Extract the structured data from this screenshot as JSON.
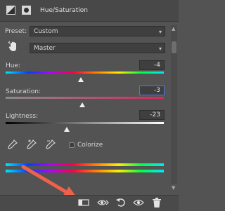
{
  "header": {
    "title": "Hue/Saturation",
    "icons": [
      "adjustment-layer-icon",
      "mask-icon"
    ]
  },
  "preset": {
    "label": "Preset:",
    "value": "Custom"
  },
  "channel": {
    "value": "Master",
    "icon": "targeted-adjustment-hand-icon"
  },
  "hue": {
    "label": "Hue:",
    "value": "-4",
    "level": -4
  },
  "saturation": {
    "label": "Saturation:",
    "value": "-3",
    "level": -3
  },
  "lightness": {
    "label": "Lightness:",
    "value": "-23",
    "level": -23
  },
  "eyedroppers": [
    "eyedropper-icon",
    "eyedropper-plus-icon",
    "eyedropper-minus-icon"
  ],
  "colorize": {
    "label": "Colorize",
    "checked": false
  },
  "footer": {
    "icons": [
      "clip-to-layer-icon",
      "view-previous-state-icon",
      "reset-icon",
      "visibility-eye-icon",
      "trash-icon"
    ]
  },
  "colors": {
    "panel_bg": "#535353",
    "header_bg": "#484848",
    "field_bg": "#3f3f3f",
    "active_border": "#4b7bd6",
    "arrow_annotation": "#f0614b"
  }
}
